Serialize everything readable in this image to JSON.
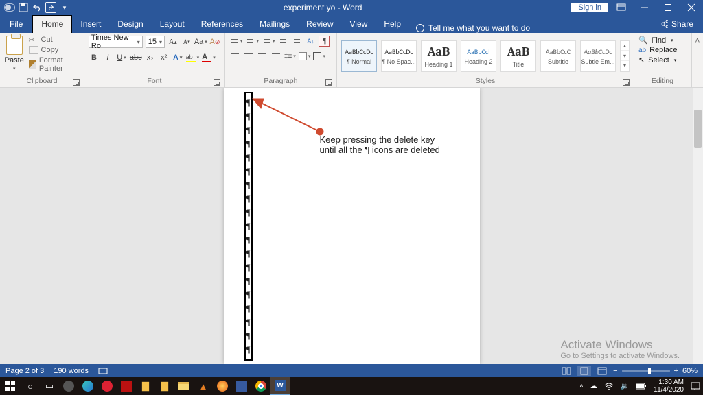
{
  "titlebar": {
    "doc_title": "experiment yo  -  Word",
    "signin": "Sign in"
  },
  "tabs": {
    "file": "File",
    "home": "Home",
    "insert": "Insert",
    "design": "Design",
    "layout": "Layout",
    "references": "References",
    "mailings": "Mailings",
    "review": "Review",
    "view": "View",
    "help": "Help",
    "tellme": "Tell me what you want to do",
    "share": "Share"
  },
  "clipboard": {
    "paste": "Paste",
    "cut": "Cut",
    "copy": "Copy",
    "format_painter": "Format Painter",
    "group": "Clipboard"
  },
  "font": {
    "family": "Times New Ro",
    "size": "15",
    "group": "Font",
    "bold": "B",
    "italic": "I",
    "under": "U",
    "strike": "abc",
    "sub": "x₂",
    "sup": "x²"
  },
  "paragraph": {
    "group": "Paragraph"
  },
  "styles": {
    "group": "Styles",
    "tiles": [
      {
        "preview": "AaBbCcDc",
        "name": "¶ Normal"
      },
      {
        "preview": "AaBbCcDc",
        "name": "¶ No Spac..."
      },
      {
        "preview": "AaB",
        "name": "Heading 1"
      },
      {
        "preview": "AaBbCcI",
        "name": "Heading 2"
      },
      {
        "preview": "AaB",
        "name": "Title"
      },
      {
        "preview": "AaBbCcC",
        "name": "Subtitle"
      },
      {
        "preview": "AaBbCcDc",
        "name": "Subtle Em..."
      }
    ]
  },
  "editing": {
    "find": "Find",
    "replace": "Replace",
    "select": "Select",
    "group": "Editing"
  },
  "document": {
    "pilcrows": [
      "¶",
      "¶",
      "¶",
      "¶",
      "¶",
      "¶",
      "¶",
      "¶",
      "¶",
      "¶",
      "¶",
      "¶",
      "¶",
      "¶",
      "¶",
      "¶",
      "¶",
      "¶",
      "¶"
    ],
    "callout_l1": "Keep pressing the delete key",
    "callout_l2": "until all the ¶ icons are deleted"
  },
  "watermark": {
    "title": "Activate Windows",
    "sub": "Go to Settings to activate Windows."
  },
  "status": {
    "page": "Page 2 of 3",
    "words": "190 words",
    "zoom": "60%"
  },
  "tray": {
    "time": "1:30 AM",
    "date": "11/4/2020"
  }
}
